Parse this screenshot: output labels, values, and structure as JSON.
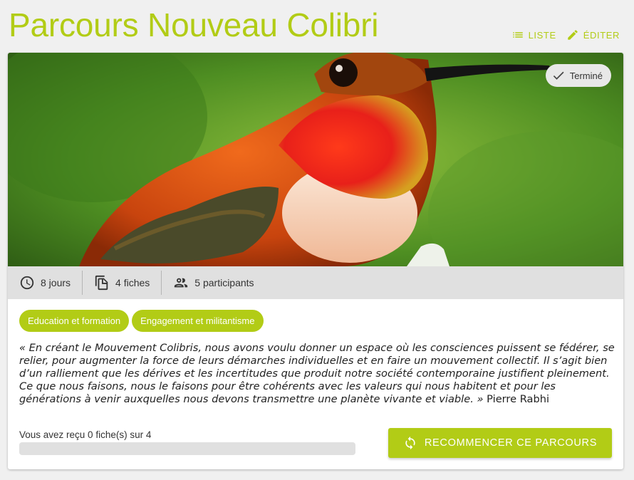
{
  "page": {
    "title": "Parcours Nouveau Colibri"
  },
  "actions": {
    "list": {
      "label": "LISTE",
      "icon": "list-icon"
    },
    "edit": {
      "label": "ÉDITER",
      "icon": "pencil-icon"
    }
  },
  "hero": {
    "image": "hummingbird-photo",
    "status": {
      "label": "Terminé",
      "icon": "check-icon"
    }
  },
  "meta": [
    {
      "icon": "clock-icon",
      "label": "8 jours"
    },
    {
      "icon": "files-icon",
      "label": "4 fiches"
    },
    {
      "icon": "people-icon",
      "label": "5 participants"
    }
  ],
  "tags": [
    "Education et formation",
    "Engagement et militantisme"
  ],
  "quote": {
    "text": "« En créant le Mouvement Colibris, nous avons voulu donner un espace où les consciences puissent se fédérer, se relier, pour augmenter la force de leurs démarches individuelles et en faire un mouvement collectif. Il s’agit bien d’un ralliement que les dérives et les incertitudes que produit notre société contemporaine justifient pleinement. Ce que nous faisons, nous le faisons pour être cohérents avec les valeurs qui nous habitent et pour les générations à venir auxquelles nous devons transmettre une planète vivante et viable. »",
    "author": "Pierre Rabhi"
  },
  "progress": {
    "label": "Vous avez reçu 0 fiche(s) sur 4",
    "received": 0,
    "total": 4
  },
  "restart": {
    "label": "RECOMMENCER CE PARCOURS",
    "icon": "sync-icon"
  },
  "colors": {
    "accent": "#b2cc16",
    "background": "#f0f0f0",
    "meta_bar": "#e0e0e0"
  }
}
